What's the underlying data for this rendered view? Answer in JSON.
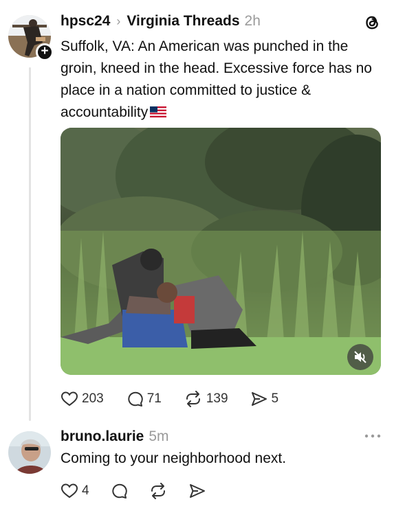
{
  "post": {
    "username": "hpsc24",
    "crumb_separator": "›",
    "group": "Virginia Threads",
    "time": "2h",
    "text": "Suffolk, VA: An American was punched in the groin, kneed in the head. Excessive force has no place in a nation committed to justice & accountability",
    "flag_icon": "us-flag-icon",
    "media_icon": "video-muted-icon",
    "actions": {
      "likes": "203",
      "comments": "71",
      "reposts": "139",
      "shares": "5"
    }
  },
  "reply": {
    "username": "bruno.laurie",
    "time": "5m",
    "text": "Coming to your neighborhood next.",
    "actions": {
      "likes": "4"
    }
  },
  "colors": {
    "text": "#111111",
    "muted": "#9a9a9a",
    "thread_line": "#e3e3e3"
  }
}
